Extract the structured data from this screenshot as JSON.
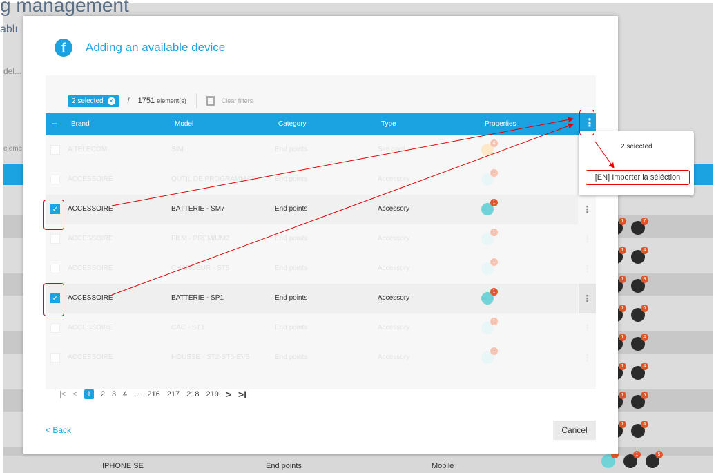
{
  "background": {
    "title": "g management",
    "subtitle": "ablı",
    "search_placeholder": "del...",
    "elements_label": "eleme",
    "bottom_row": {
      "model": "IPHONE SE",
      "category": "End points",
      "type": "Mobile"
    },
    "row_badges": [
      [
        "1",
        "7"
      ],
      [
        "1",
        "4"
      ],
      [
        "1",
        "3"
      ],
      [
        "1",
        "6"
      ],
      [
        "1",
        "4"
      ],
      [
        "1",
        "4"
      ],
      [
        "1",
        "5"
      ],
      [
        "1",
        "4"
      ],
      [
        "7",
        "1",
        "5"
      ]
    ]
  },
  "modal": {
    "title": "Adding an available device",
    "logo_glyph": "f",
    "toolbar": {
      "selected_label": "2 selected",
      "slash": "/",
      "count_value": "1751",
      "count_unit": "element(s)",
      "clear_filters": "Clear filters"
    },
    "columns": {
      "minus": "–",
      "brand": "Brand",
      "model": "Model",
      "category": "Category",
      "type": "Type",
      "properties": "Properties"
    },
    "rows": [
      {
        "brand": "A TELECOM",
        "model": "SIM",
        "category": "End points",
        "type": "Sim card",
        "badge": "4"
      },
      {
        "brand": "ACCESSOIRE",
        "model": "OUTIL DE PROGRAMMATI",
        "category": "End points",
        "type": "Accessory",
        "badge": "1"
      },
      {
        "brand": "ACCESSOIRE",
        "model": "BATTERIE - SM7",
        "category": "End points",
        "type": "Accessory",
        "badge": "1",
        "checked": true
      },
      {
        "brand": "ACCESSOIRE",
        "model": "FILM - PREMIUM2",
        "category": "End points",
        "type": "Accessory",
        "badge": "1"
      },
      {
        "brand": "ACCESSOIRE",
        "model": "CHARGEUR - ST5",
        "category": "End points",
        "type": "Accessory",
        "badge": "1"
      },
      {
        "brand": "ACCESSOIRE",
        "model": "BATTERIE - SP1",
        "category": "End points",
        "type": "Accessory",
        "badge": "1",
        "checked": true
      },
      {
        "brand": "ACCESSOIRE",
        "model": "CAC - ST1",
        "category": "End points",
        "type": "Accessory",
        "badge": "1"
      },
      {
        "brand": "ACCESSOIRE",
        "model": "HOUSSE - ST2-ST5-EV5",
        "category": "End points",
        "type": "Accessory",
        "badge": "1"
      }
    ],
    "pagination": {
      "first": "|<",
      "prev": "<",
      "pages": [
        "1",
        "2",
        "3",
        "4",
        "...",
        "216",
        "217",
        "218",
        "219"
      ],
      "next": ">",
      "last": ">I"
    },
    "back": "< Back",
    "cancel": "Cancel"
  },
  "popover": {
    "selected": "2 selected",
    "import_label": "[EN] Importer la séléction"
  },
  "colors": {
    "accent": "#1aa3e0",
    "badge": "#e1552b",
    "annotation": "#e00000"
  }
}
